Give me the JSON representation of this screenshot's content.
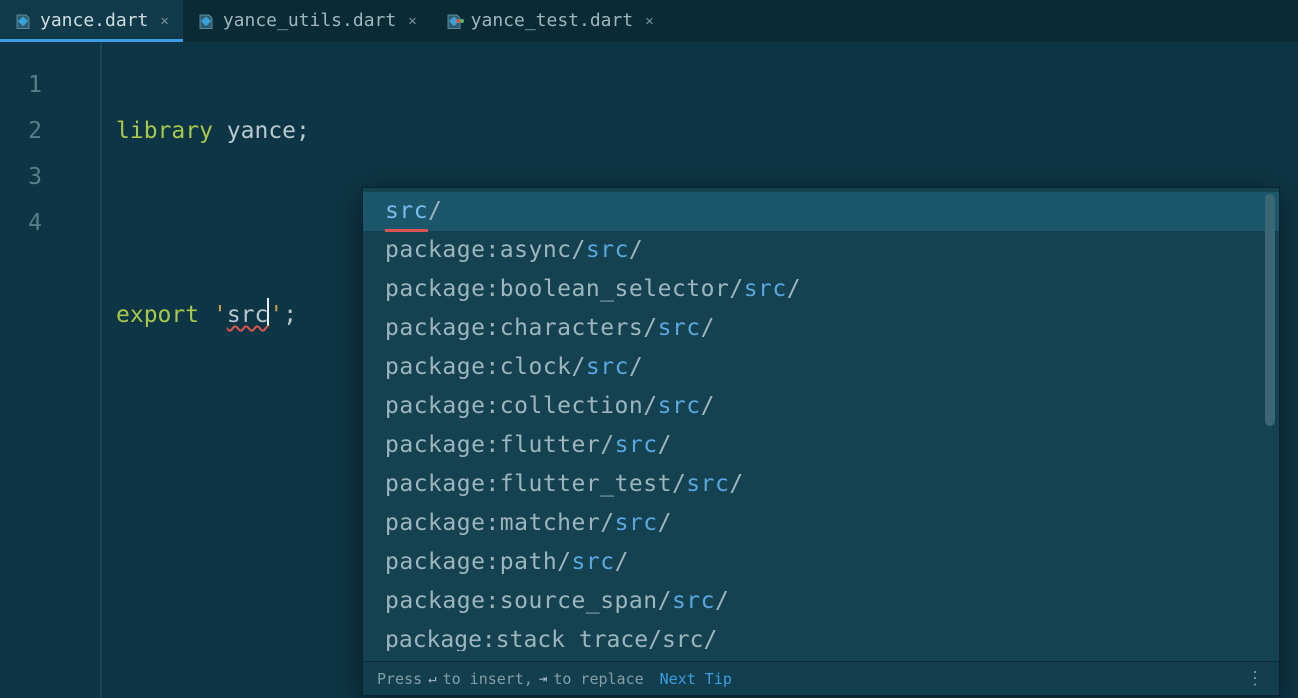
{
  "tabs": [
    {
      "label": "yance.dart",
      "active": true,
      "test": false
    },
    {
      "label": "yance_utils.dart",
      "active": false,
      "test": false
    },
    {
      "label": "yance_test.dart",
      "active": false,
      "test": true
    }
  ],
  "gutter": [
    "1",
    "2",
    "3",
    "4"
  ],
  "code": {
    "library_kw": "library",
    "library_name": "yance",
    "export_kw": "export",
    "export_path": "src",
    "quote": "'",
    "semi": ";"
  },
  "completion": {
    "items": [
      {
        "prefix": "",
        "match": "src",
        "suffix": "/",
        "selected": true,
        "underline": true
      },
      {
        "prefix": "package:async/",
        "match": "src",
        "suffix": "/",
        "selected": false
      },
      {
        "prefix": "package:boolean_selector/",
        "match": "src",
        "suffix": "/",
        "selected": false
      },
      {
        "prefix": "package:characters/",
        "match": "src",
        "suffix": "/",
        "selected": false
      },
      {
        "prefix": "package:clock/",
        "match": "src",
        "suffix": "/",
        "selected": false
      },
      {
        "prefix": "package:collection/",
        "match": "src",
        "suffix": "/",
        "selected": false
      },
      {
        "prefix": "package:flutter/",
        "match": "src",
        "suffix": "/",
        "selected": false
      },
      {
        "prefix": "package:flutter_test/",
        "match": "src",
        "suffix": "/",
        "selected": false
      },
      {
        "prefix": "package:matcher/",
        "match": "src",
        "suffix": "/",
        "selected": false
      },
      {
        "prefix": "package:path/",
        "match": "src",
        "suffix": "/",
        "selected": false
      },
      {
        "prefix": "package:source_span/",
        "match": "src",
        "suffix": "/",
        "selected": false
      }
    ],
    "partial": {
      "prefix": "package:stack_trace/",
      "match": "src",
      "suffix": "/"
    },
    "footer": {
      "press": "Press",
      "insert": "to insert,",
      "replace": "to replace",
      "next_tip": "Next Tip",
      "enter_glyph": "↵",
      "tab_glyph": "⇥"
    }
  }
}
